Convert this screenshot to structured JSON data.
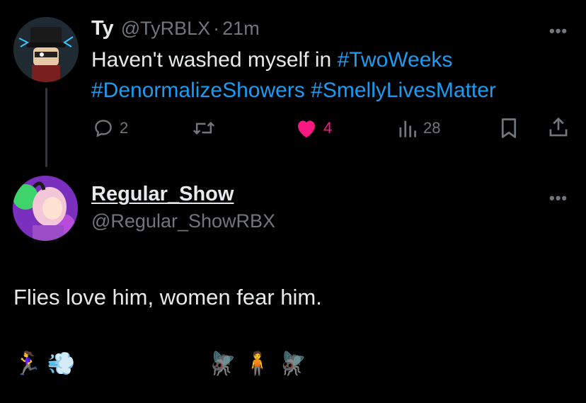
{
  "tweet": {
    "author_name": "Ty",
    "handle": "@TyRBLX",
    "separator": "·",
    "time": "21m",
    "text_plain": "Haven't washed myself in ",
    "hashtags": [
      "#TwoWeeks",
      "#DenormalizeShowers",
      "#SmellyLivesMatter"
    ],
    "more_label": "•••",
    "actions": {
      "reply_count": "2",
      "retweet_count": "",
      "like_count": "4",
      "views_count": "28"
    }
  },
  "reply": {
    "author_name": "Regular_Show",
    "handle": "@Regular_ShowRBX",
    "more_label": "•••",
    "text": "Flies love him, women fear him.",
    "emoji_left": "🏃‍♀️💨",
    "emoji_right": "🪰🧍🪰"
  },
  "colors": {
    "background": "#000000",
    "text": "#e7e9ea",
    "muted": "#71767b",
    "link": "#1d9bf0",
    "like": "#f91880"
  },
  "icons": [
    "reply-icon",
    "retweet-icon",
    "heart-icon",
    "views-icon",
    "bookmark-icon",
    "share-icon",
    "more-icon"
  ]
}
